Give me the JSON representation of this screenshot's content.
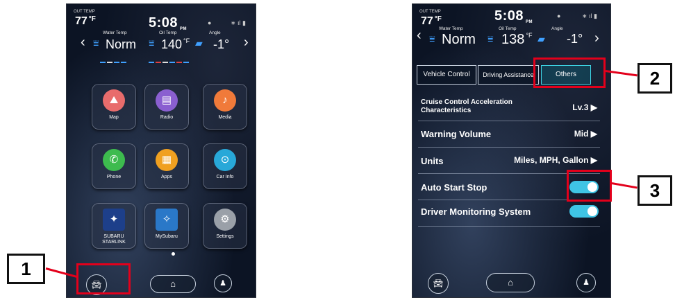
{
  "left_screen": {
    "status": {
      "out_temp_label": "OUT TEMP",
      "out_temp": "77",
      "out_temp_unit": "°F",
      "clock": "5:08",
      "clock_suffix": "PM"
    },
    "gauges": {
      "water_temp_label": "Water Temp",
      "water_temp": "Norm",
      "oil_temp_label": "Oil Temp",
      "oil_temp": "140",
      "oil_temp_unit": "°F",
      "angle_label": "Angle",
      "angle": "-1°"
    },
    "apps": [
      {
        "label": "Map",
        "icon": "map-icon",
        "color": "#e86c6c"
      },
      {
        "label": "Radio",
        "icon": "radio-icon",
        "color": "#8a5fd0"
      },
      {
        "label": "Media",
        "icon": "media-icon",
        "color": "#f07a3a"
      },
      {
        "label": "Phone",
        "icon": "phone-icon",
        "color": "#3dbb4e"
      },
      {
        "label": "Apps",
        "icon": "apps-icon",
        "color": "#f0a020"
      },
      {
        "label": "Car Info",
        "icon": "car-info-icon",
        "color": "#28a8d8"
      },
      {
        "label": "SUBARU STARLINK",
        "icon": "starlink-icon",
        "color": "#1d3f8a"
      },
      {
        "label": "MySubaru",
        "icon": "mysubaru-icon",
        "color": "#2a78c8"
      },
      {
        "label": "Settings",
        "icon": "settings-gear-icon",
        "color": "#9aa0a8"
      }
    ]
  },
  "right_screen": {
    "status": {
      "out_temp_label": "OUT TEMP",
      "out_temp": "77",
      "out_temp_unit": "°F",
      "clock": "5:08",
      "clock_suffix": "PM"
    },
    "gauges": {
      "water_temp_label": "Water Temp",
      "water_temp": "Norm",
      "oil_temp_label": "Oil Temp",
      "oil_temp": "138",
      "oil_temp_unit": "°F",
      "angle_label": "Angle",
      "angle": "-1°"
    },
    "tabs": [
      "Vehicle Control",
      "Driving Assistance",
      "Others"
    ],
    "active_tab": "Others",
    "settings": [
      {
        "name": "Cruise Control Acceleration Characteristics",
        "value": "Lv.3"
      },
      {
        "name": "Warning Volume",
        "value": "Mid"
      },
      {
        "name": "Units",
        "value": "Miles, MPH, Gallon"
      },
      {
        "name": "Auto Start Stop",
        "toggle": true
      },
      {
        "name": "Driver Monitoring System",
        "toggle": true
      }
    ]
  },
  "annotations": [
    "1",
    "2",
    "3"
  ],
  "colors": {
    "annotation": "#e3001b",
    "accent": "#3fc4e4"
  }
}
